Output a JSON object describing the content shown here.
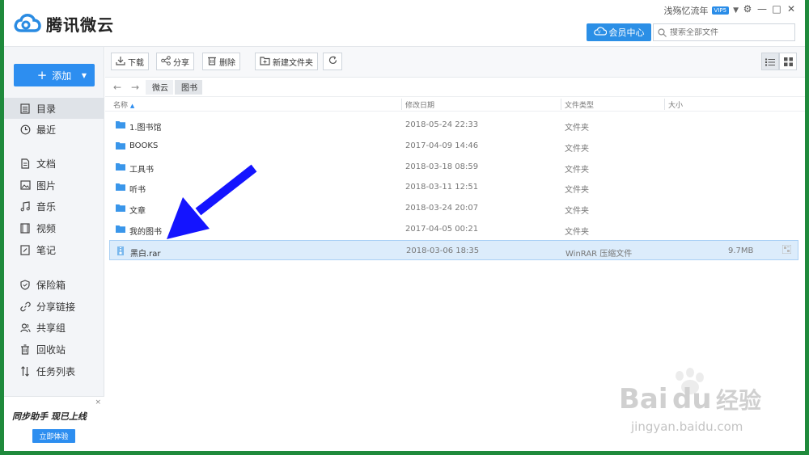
{
  "app": {
    "brand": "腾讯微云"
  },
  "topbar": {
    "username": "浅殇忆流年",
    "vip": "VIP5",
    "member_center": "会员中心",
    "search_placeholder": "搜索全部文件",
    "window_controls": [
      "gear-icon",
      "minimize-icon",
      "maximize-icon",
      "close-icon"
    ]
  },
  "sidebar": {
    "add_label": "添加",
    "items": [
      {
        "label": "目录",
        "icon": "directory-icon",
        "active": true
      },
      {
        "label": "最近",
        "icon": "clock-icon"
      },
      {
        "label": "文档",
        "icon": "document-icon"
      },
      {
        "label": "图片",
        "icon": "image-icon"
      },
      {
        "label": "音乐",
        "icon": "music-icon"
      },
      {
        "label": "视频",
        "icon": "video-icon"
      },
      {
        "label": "笔记",
        "icon": "note-icon"
      },
      {
        "label": "保险箱",
        "icon": "shield-icon"
      },
      {
        "label": "分享链接",
        "icon": "link-icon"
      },
      {
        "label": "共享组",
        "icon": "group-icon"
      },
      {
        "label": "回收站",
        "icon": "trash-icon"
      },
      {
        "label": "任务列表",
        "icon": "transfer-icon"
      }
    ],
    "promo": {
      "text": "同步助手 现已上线",
      "button": "立即体验",
      "close": "×"
    }
  },
  "toolbar": {
    "download": "下载",
    "share": "分享",
    "delete": "删除",
    "new_folder": "新建文件夹"
  },
  "path": {
    "root": "微云",
    "current": "图书"
  },
  "table": {
    "headers": {
      "name": "名称",
      "modified": "修改日期",
      "type": "文件类型",
      "size": "大小"
    },
    "rows": [
      {
        "name": "1.图书馆",
        "date": "2018-05-24 22:33",
        "type": "文件夹",
        "size": "",
        "kind": "folder"
      },
      {
        "name": "BOOKS",
        "date": "2017-04-09 14:46",
        "type": "文件夹",
        "size": "",
        "kind": "folder"
      },
      {
        "name": "工具书",
        "date": "2018-03-18 08:59",
        "type": "文件夹",
        "size": "",
        "kind": "folder"
      },
      {
        "name": "听书",
        "date": "2018-03-11 12:51",
        "type": "文件夹",
        "size": "",
        "kind": "folder"
      },
      {
        "name": "文章",
        "date": "2018-03-24 20:07",
        "type": "文件夹",
        "size": "",
        "kind": "folder"
      },
      {
        "name": "我的图书",
        "date": "2017-04-05 00:21",
        "type": "文件夹",
        "size": "",
        "kind": "folder"
      },
      {
        "name": "黑白.rar",
        "date": "2018-03-06 18:35",
        "type": "WinRAR 压缩文件",
        "size": "9.7MB",
        "kind": "archive",
        "selected": true
      }
    ]
  },
  "watermark": {
    "brand": "Bai",
    "brand2": "du",
    "cn": "经验",
    "url": "jingyan.baidu.com"
  },
  "colors": {
    "accent": "#2d8ef0",
    "folder": "#3a96ea",
    "arrow": "#1414ff",
    "selected_row": "#dcecfb",
    "frame": "#1f8a3c"
  }
}
